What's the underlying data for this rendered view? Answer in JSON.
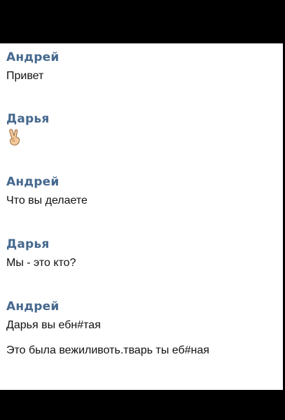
{
  "messages": [
    {
      "author": "Андрей",
      "text": "Привет"
    },
    {
      "author": "Дарья",
      "emoji": "victory-hand-emoji"
    },
    {
      "author": "Андрей",
      "text": "Что вы делаете"
    },
    {
      "author": "Дарья",
      "text": "Мы - это кто?"
    },
    {
      "author": "Андрей",
      "text": "Дарья вы ебн#тая",
      "text2": "Это была вежиливоть.тварь ты еб#ная"
    }
  ]
}
